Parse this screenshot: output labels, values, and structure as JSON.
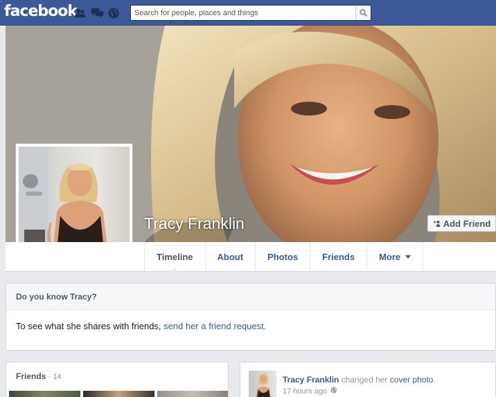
{
  "header": {
    "logo": "facebook",
    "search_placeholder": "Search for people, places and things",
    "jewels": [
      "friend-requests-icon",
      "messages-icon",
      "notifications-globe-icon"
    ]
  },
  "profile": {
    "name": "Tracy Franklin",
    "add_friend_label": "Add Friend"
  },
  "nav": {
    "tabs": [
      {
        "label": "Timeline",
        "active": true
      },
      {
        "label": "About"
      },
      {
        "label": "Photos"
      },
      {
        "label": "Friends"
      },
      {
        "label": "More"
      }
    ]
  },
  "know_box": {
    "title": "Do you know Tracy?",
    "body_prefix": "To see what she shares with friends, ",
    "body_link": "send her a friend request."
  },
  "friends_box": {
    "title": "Friends",
    "count": "· 14"
  },
  "story": {
    "actor": "Tracy Franklin",
    "verb": " changed her ",
    "object": "cover photo",
    "suffix": ".",
    "time": "17 hours ago",
    "privacy_icon": "globe-icon"
  },
  "colors": {
    "brand": "#3b5998",
    "page_bg": "#e9eaed",
    "muted_text": "#9197a3"
  }
}
